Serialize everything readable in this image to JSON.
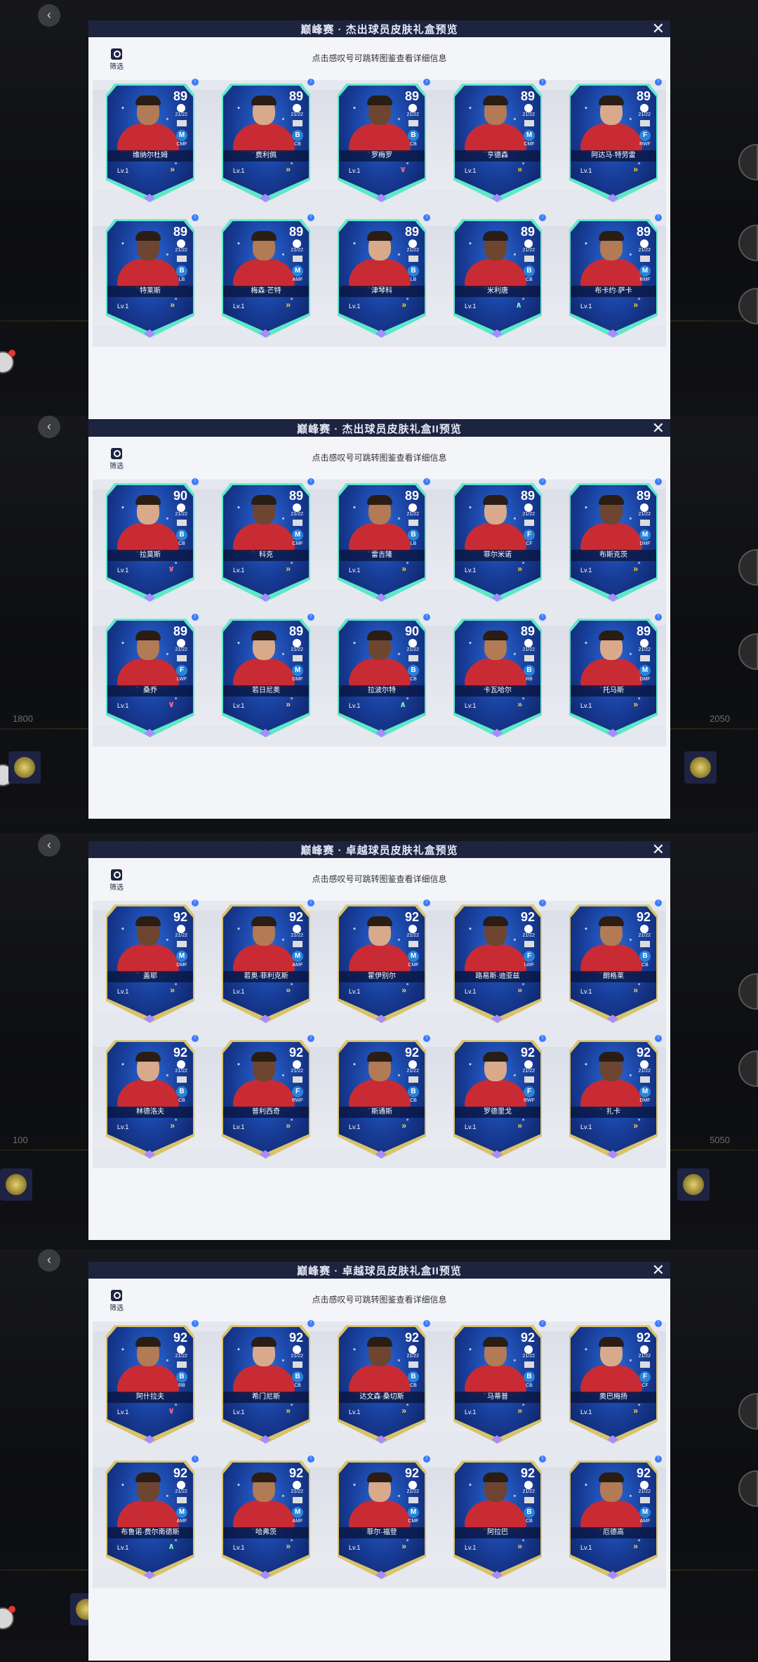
{
  "panels": [
    {
      "title": "巅峰赛 · 杰出球员皮肤礼盒预览",
      "subtitle": "点击感叹号可跳转图鉴查看详细信息",
      "filter_label": "筛选",
      "cards": [
        {
          "name": "维纳尔杜姆",
          "rating": "89",
          "season": "21/22",
          "pos": "M",
          "pos_label": "CMF",
          "arrow": "»",
          "arrow_color": "#f3d34a",
          "lv": "Lv.1"
        },
        {
          "name": "费利佩",
          "rating": "89",
          "season": "21/22",
          "pos": "B",
          "pos_label": "CB",
          "arrow": "»",
          "arrow_color": "#f3d34a",
          "lv": "Lv.1"
        },
        {
          "name": "罗梅罗",
          "rating": "89",
          "season": "21/22",
          "pos": "B",
          "pos_label": "CB",
          "arrow": "∨",
          "arrow_color": "#ff6b8a",
          "lv": "Lv.1"
        },
        {
          "name": "亨德森",
          "rating": "89",
          "season": "21/22",
          "pos": "M",
          "pos_label": "CMF",
          "arrow": "»",
          "arrow_color": "#f3d34a",
          "lv": "Lv.1"
        },
        {
          "name": "阿达马·特劳雷",
          "rating": "89",
          "season": "21/22",
          "pos": "F",
          "pos_label": "RWF",
          "arrow": "»",
          "arrow_color": "#f3d34a",
          "lv": "Lv.1"
        },
        {
          "name": "特莱斯",
          "rating": "89",
          "season": "21/22",
          "pos": "B",
          "pos_label": "LB",
          "arrow": "»",
          "arrow_color": "#f3d34a",
          "lv": "Lv.1"
        },
        {
          "name": "梅森·芒特",
          "rating": "89",
          "season": "21/22",
          "pos": "M",
          "pos_label": "AMF",
          "arrow": "»",
          "arrow_color": "#f3d34a",
          "lv": "Lv.1"
        },
        {
          "name": "津琴科",
          "rating": "89",
          "season": "21/22",
          "pos": "B",
          "pos_label": "LB",
          "arrow": "»",
          "arrow_color": "#f3d34a",
          "lv": "Lv.1"
        },
        {
          "name": "米利唐",
          "rating": "89",
          "season": "21/22",
          "pos": "B",
          "pos_label": "CB",
          "arrow": "∧",
          "arrow_color": "#7ef0c0",
          "lv": "Lv.1"
        },
        {
          "name": "布卡约·萨卡",
          "rating": "89",
          "season": "21/22",
          "pos": "M",
          "pos_label": "RMF",
          "arrow": "»",
          "arrow_color": "#f3d34a",
          "lv": "Lv.1"
        }
      ]
    },
    {
      "title": "巅峰赛 · 杰出球员皮肤礼盒II预览",
      "subtitle": "点击感叹号可跳转图鉴查看详细信息",
      "filter_label": "筛选",
      "cards": [
        {
          "name": "拉莫斯",
          "rating": "90",
          "season": "21/22",
          "pos": "B",
          "pos_label": "CB",
          "arrow": "∨",
          "arrow_color": "#ff6b8a",
          "lv": "Lv.1"
        },
        {
          "name": "科克",
          "rating": "89",
          "season": "21/22",
          "pos": "M",
          "pos_label": "CMF",
          "arrow": "»",
          "arrow_color": "#f3d34a",
          "lv": "Lv.1"
        },
        {
          "name": "雷吉隆",
          "rating": "89",
          "season": "21/22",
          "pos": "B",
          "pos_label": "LB",
          "arrow": "»",
          "arrow_color": "#f3d34a",
          "lv": "Lv.1"
        },
        {
          "name": "菲尔米诺",
          "rating": "89",
          "season": "21/22",
          "pos": "F",
          "pos_label": "CF",
          "arrow": "»",
          "arrow_color": "#f3d34a",
          "lv": "Lv.1"
        },
        {
          "name": "布斯克茨",
          "rating": "89",
          "season": "21/22",
          "pos": "M",
          "pos_label": "DMF",
          "arrow": "»",
          "arrow_color": "#f3d34a",
          "lv": "Lv.1"
        },
        {
          "name": "桑乔",
          "rating": "89",
          "season": "21/22",
          "pos": "F",
          "pos_label": "LWF",
          "arrow": "∨",
          "arrow_color": "#ff6b8a",
          "lv": "Lv.1"
        },
        {
          "name": "若日尼奥",
          "rating": "89",
          "season": "21/22",
          "pos": "M",
          "pos_label": "DMF",
          "arrow": "»",
          "arrow_color": "#f3d34a",
          "lv": "Lv.1"
        },
        {
          "name": "拉波尔特",
          "rating": "90",
          "season": "21/22",
          "pos": "B",
          "pos_label": "CB",
          "arrow": "∧",
          "arrow_color": "#7ef0c0",
          "lv": "Lv.1"
        },
        {
          "name": "卡瓦哈尔",
          "rating": "89",
          "season": "21/22",
          "pos": "B",
          "pos_label": "RB",
          "arrow": "»",
          "arrow_color": "#f3d34a",
          "lv": "Lv.1"
        },
        {
          "name": "托马斯",
          "rating": "89",
          "season": "21/22",
          "pos": "M",
          "pos_label": "DMF",
          "arrow": "»",
          "arrow_color": "#f3d34a",
          "lv": "Lv.1"
        }
      ]
    },
    {
      "title": "巅峰赛 · 卓越球员皮肤礼盒预览",
      "subtitle": "点击感叹号可跳转图鉴查看详细信息",
      "filter_label": "筛选",
      "cards": [
        {
          "name": "盖耶",
          "rating": "92",
          "season": "21/22",
          "pos": "M",
          "pos_label": "DMF",
          "arrow": "»",
          "arrow_color": "#f3d34a",
          "lv": "Lv.1"
        },
        {
          "name": "若奥·菲利克斯",
          "rating": "92",
          "season": "21/22",
          "pos": "M",
          "pos_label": "AMF",
          "arrow": "»",
          "arrow_color": "#f3d34a",
          "lv": "Lv.1"
        },
        {
          "name": "霍伊别尔",
          "rating": "92",
          "season": "21/22",
          "pos": "M",
          "pos_label": "CMF",
          "arrow": "»",
          "arrow_color": "#f3d34a",
          "lv": "Lv.1"
        },
        {
          "name": "路易斯·迪亚兹",
          "rating": "92",
          "season": "21/22",
          "pos": "F",
          "pos_label": "LWF",
          "arrow": "»",
          "arrow_color": "#f3d34a",
          "lv": "Lv.1"
        },
        {
          "name": "朗格莱",
          "rating": "92",
          "season": "21/22",
          "pos": "B",
          "pos_label": "CB",
          "arrow": "»",
          "arrow_color": "#f3d34a",
          "lv": "Lv.1"
        },
        {
          "name": "林德洛夫",
          "rating": "92",
          "season": "21/22",
          "pos": "B",
          "pos_label": "CB",
          "arrow": "»",
          "arrow_color": "#f3d34a",
          "lv": "Lv.1"
        },
        {
          "name": "普利西奇",
          "rating": "92",
          "season": "21/22",
          "pos": "F",
          "pos_label": "RWF",
          "arrow": "»",
          "arrow_color": "#f3d34a",
          "lv": "Lv.1"
        },
        {
          "name": "斯通斯",
          "rating": "92",
          "season": "21/22",
          "pos": "B",
          "pos_label": "CB",
          "arrow": "»",
          "arrow_color": "#f3d34a",
          "lv": "Lv.1"
        },
        {
          "name": "罗德里戈",
          "rating": "92",
          "season": "21/22",
          "pos": "F",
          "pos_label": "RWF",
          "arrow": "»",
          "arrow_color": "#f3d34a",
          "lv": "Lv.1"
        },
        {
          "name": "扎卡",
          "rating": "92",
          "season": "21/22",
          "pos": "M",
          "pos_label": "DMF",
          "arrow": "»",
          "arrow_color": "#f3d34a",
          "lv": "Lv.1"
        }
      ]
    },
    {
      "title": "巅峰赛 · 卓越球员皮肤礼盒II预览",
      "subtitle": "点击感叹号可跳转图鉴查看详细信息",
      "filter_label": "筛选",
      "cards": [
        {
          "name": "阿什拉夫",
          "rating": "92",
          "season": "21/22",
          "pos": "B",
          "pos_label": "RB",
          "arrow": "∨",
          "arrow_color": "#ff6b8a",
          "lv": "Lv.1"
        },
        {
          "name": "希门尼斯",
          "rating": "92",
          "season": "21/22",
          "pos": "B",
          "pos_label": "CB",
          "arrow": "»",
          "arrow_color": "#f3d34a",
          "lv": "Lv.1"
        },
        {
          "name": "达文森·桑切斯",
          "rating": "92",
          "season": "21/22",
          "pos": "B",
          "pos_label": "CB",
          "arrow": "»",
          "arrow_color": "#f3d34a",
          "lv": "Lv.1"
        },
        {
          "name": "马蒂普",
          "rating": "92",
          "season": "21/22",
          "pos": "B",
          "pos_label": "CB",
          "arrow": "»",
          "arrow_color": "#f3d34a",
          "lv": "Lv.1"
        },
        {
          "name": "奥巴梅扬",
          "rating": "92",
          "season": "21/22",
          "pos": "F",
          "pos_label": "CF",
          "arrow": "»",
          "arrow_color": "#f3d34a",
          "lv": "Lv.1"
        },
        {
          "name": "布鲁诺·费尔南德斯",
          "rating": "92",
          "season": "21/22",
          "pos": "M",
          "pos_label": "AMF",
          "arrow": "∧",
          "arrow_color": "#7ef0c0",
          "lv": "Lv.1"
        },
        {
          "name": "哈弗茨",
          "rating": "92",
          "season": "21/22",
          "pos": "M",
          "pos_label": "AMF",
          "arrow": "»",
          "arrow_color": "#f3d34a",
          "lv": "Lv.1"
        },
        {
          "name": "菲尔·福登",
          "rating": "92",
          "season": "21/22",
          "pos": "M",
          "pos_label": "CMF",
          "arrow": "»",
          "arrow_color": "#f3d34a",
          "lv": "Lv.1"
        },
        {
          "name": "阿拉巴",
          "rating": "92",
          "season": "21/22",
          "pos": "B",
          "pos_label": "CB",
          "arrow": "»",
          "arrow_color": "#f3d34a",
          "lv": "Lv.1"
        },
        {
          "name": "厄德高",
          "rating": "92",
          "season": "21/22",
          "pos": "M",
          "pos_label": "AMF",
          "arrow": "»",
          "arrow_color": "#f3d34a",
          "lv": "Lv.1"
        }
      ]
    }
  ],
  "background": {
    "ticks": [
      {
        "left": "1800",
        "right": "2050"
      },
      {
        "left": "100",
        "right": "5050"
      }
    ]
  },
  "colors": {
    "accent_header": "#1d2440",
    "panel_bg": "#f4f5f8",
    "card_border_outstanding": "#5ee8c9",
    "card_border_excellent": "#d8c36b"
  }
}
